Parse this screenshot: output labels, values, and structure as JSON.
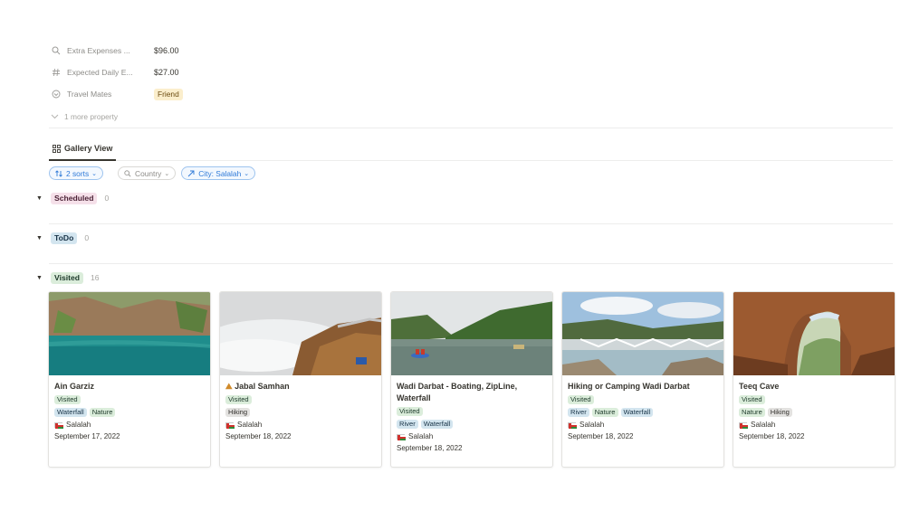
{
  "properties": [
    {
      "icon": "search-icon",
      "name": "Extra Expenses ...",
      "value": "$96.00"
    },
    {
      "icon": "hash-icon",
      "name": "Expected Daily E...",
      "value": "$27.00"
    },
    {
      "icon": "person-circle-icon",
      "name": "Travel Mates",
      "value": "Friend"
    }
  ],
  "more_property": "1 more property",
  "view_tab": "Gallery View",
  "filters": {
    "sorts": "2 sorts",
    "country": "Country",
    "city": "City: Salalah"
  },
  "groups": [
    {
      "label": "Scheduled",
      "count": "0"
    },
    {
      "label": "ToDo",
      "count": "0"
    },
    {
      "label": "Visited",
      "count": "16"
    }
  ],
  "cards": [
    {
      "title": "Ain Garziz",
      "status": "Visited",
      "tags": [
        "Waterfall",
        "Nature"
      ],
      "city": "Salalah",
      "date": "September 17, 2022"
    },
    {
      "title": "Jabal Samhan",
      "status": "Visited",
      "tags": [
        "Hiking"
      ],
      "city": "Salalah",
      "date": "September 18, 2022"
    },
    {
      "title": "Wadi Darbat - Boating, ZipLine, Waterfall",
      "status": "Visited",
      "tags": [
        "River",
        "Waterfall"
      ],
      "city": "Salalah",
      "date": "September 18, 2022"
    },
    {
      "title": "Hiking or Camping Wadi Darbat",
      "status": "Visited",
      "tags": [
        "River",
        "Nature",
        "Waterfall"
      ],
      "city": "Salalah",
      "date": "September 18, 2022"
    },
    {
      "title": "Teeq Cave",
      "status": "Visited",
      "tags": [
        "Nature",
        "Hiking"
      ],
      "city": "Salalah",
      "date": "September 18, 2022"
    }
  ]
}
